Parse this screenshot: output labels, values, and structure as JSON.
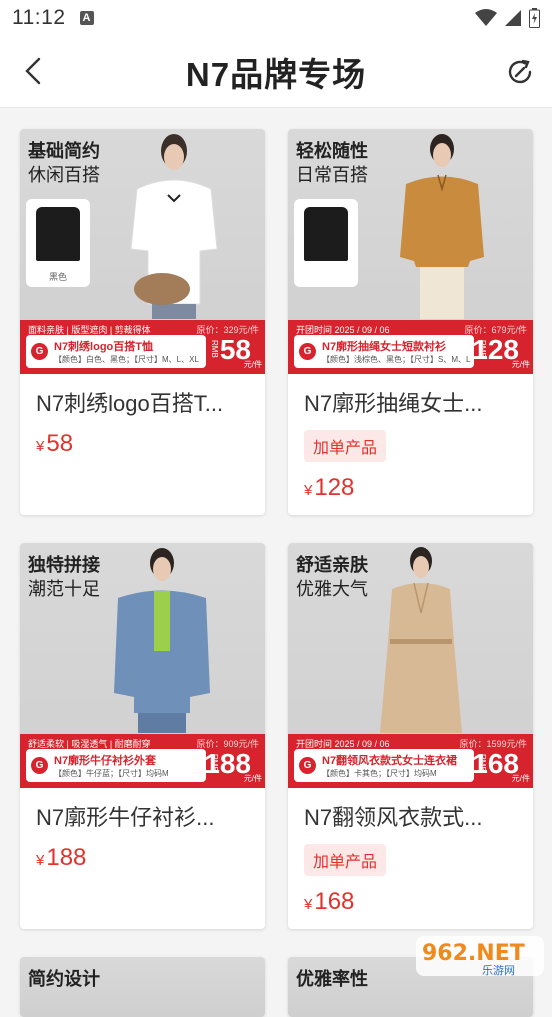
{
  "status_bar": {
    "time": "11:12",
    "notification_icon": "a-icon"
  },
  "header": {
    "title": "N7品牌专场",
    "back_icon": "chevron-left-icon",
    "refresh_icon": "refresh-icon"
  },
  "colors": {
    "accent": "#e2322e",
    "banner_red": "#d7232d",
    "tag_bg": "#fde8e8"
  },
  "products": [
    {
      "headline": "基础简约",
      "subline": "休闲百搭",
      "thumb_label": "黑色",
      "banner_line": "面料亲肤 | 版型遮肉 | 剪裁得体",
      "orig_price": "原价：329元/件",
      "banner_name": "N7刺绣logo百搭T恤",
      "banner_spec": "【颜色】白色、黑色；【尺寸】M、L、XL",
      "banner_currency": "RMB",
      "banner_price": "58",
      "banner_unit": "元/件",
      "name": "N7刺绣logo百搭T...",
      "tag": "",
      "currency": "¥",
      "price": "58",
      "garment_color": "#ffffff"
    },
    {
      "headline": "轻松随性",
      "subline": "日常百搭",
      "thumb_label": "",
      "banner_line": "开团时间  2025 / 09 / 06",
      "orig_price": "原价：679元/件",
      "banner_name": "N7廓形抽绳女士短款衬衫",
      "banner_spec": "【颜色】浅棕色、黑色；【尺寸】S、M、L",
      "banner_currency": "RMB",
      "banner_price": "128",
      "banner_unit": "元/件",
      "name": "N7廓形抽绳女士...",
      "tag": "加单产品",
      "currency": "¥",
      "price": "128",
      "garment_color": "#c98b3e"
    },
    {
      "headline": "独特拼接",
      "subline": "潮范十足",
      "thumb_label": "",
      "banner_line": "舒适柔软 | 吸湿透气 | 耐磨耐穿",
      "orig_price": "原价：909元/件",
      "banner_name": "N7廓形牛仔衬衫外套",
      "banner_spec": "【颜色】牛仔蓝；【尺寸】均码M",
      "banner_currency": "RMB",
      "banner_price": "188",
      "banner_unit": "元/件",
      "name": "N7廓形牛仔衬衫...",
      "tag": "",
      "currency": "¥",
      "price": "188",
      "garment_color": "#6f90b8"
    },
    {
      "headline": "舒适亲肤",
      "subline": "优雅大气",
      "thumb_label": "",
      "banner_line": "开团时间  2025 / 09 / 06",
      "orig_price": "原价：1599元/件",
      "banner_name": "N7翻领风衣款式女士连衣裙",
      "banner_spec": "【颜色】卡其色；【尺寸】均码M",
      "banner_currency": "RMB",
      "banner_price": "168",
      "banner_unit": "元/件",
      "name": "N7翻领风衣款式...",
      "tag": "加单产品",
      "currency": "¥",
      "price": "168",
      "garment_color": "#d8b995"
    },
    {
      "headline": "简约设计"
    },
    {
      "headline": "优雅率性"
    }
  ],
  "watermark": {
    "text": "962.NET",
    "subtext": "乐游网"
  }
}
